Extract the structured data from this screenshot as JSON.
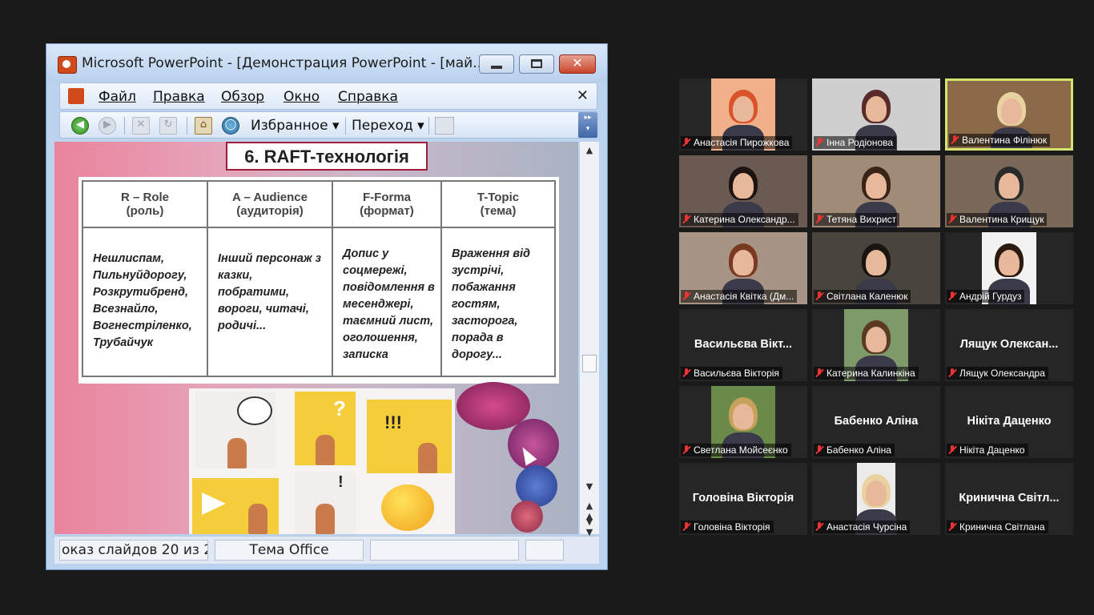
{
  "powerpoint": {
    "title": "Microsoft PowerPoint - [Демонстрация PowerPoint - [май...",
    "window_buttons": {
      "minimize": "",
      "maximize": "",
      "close": "✕"
    },
    "menu": [
      "Файл",
      "Правка",
      "Обзор",
      "Окно",
      "Справка"
    ],
    "menu_close": "✕",
    "toolbar": {
      "favorites": "Избранное ▾",
      "goto": "Переход ▾"
    },
    "slide": {
      "title": "6. RAFT-технологія",
      "headers": [
        {
          "line1": "R – Role",
          "line2": "(роль)"
        },
        {
          "line1": "A – Audience",
          "line2": "(аудиторія)"
        },
        {
          "line1": "F-Forma",
          "line2": "(формат)"
        },
        {
          "line1": "T-Topic",
          "line2": "(тема)"
        }
      ],
      "cells": [
        "Нешлиспам, Пильнуйдорогу, Розкрутибренд, Всезнайло, Вогнестріленко, Трубайчук",
        "Інший персонаж з казки, побратими, вороги, читачі, родичі...",
        "Допис у соцмережі, повідомлення в месенджері, таємний лист, оголошення, записка",
        "Враження від зустрічі, побажання гостям, засторога, порада в дорогу..."
      ],
      "collage_marks": {
        "question": "?",
        "exclaim3": "!!!",
        "exclaim": "!"
      }
    },
    "status": {
      "slides": "оказ слайдов 20 из 2",
      "theme": "Тема Office"
    }
  },
  "participants": [
    {
      "name": "Анастасія Пирожкова",
      "video": true,
      "bigname": ""
    },
    {
      "name": "Інна Родіонова",
      "video": true,
      "bigname": ""
    },
    {
      "name": "Валентина Філінюк",
      "video": true,
      "bigname": "",
      "active": true
    },
    {
      "name": "Катерина Олександр...",
      "video": true,
      "bigname": ""
    },
    {
      "name": "Тетяна Вихрист",
      "video": true,
      "bigname": ""
    },
    {
      "name": "Валентина Крищук",
      "video": true,
      "bigname": ""
    },
    {
      "name": "Анастасія Квітка (Дм...",
      "video": true,
      "bigname": ""
    },
    {
      "name": "Світлана Каленюк",
      "video": true,
      "bigname": ""
    },
    {
      "name": "Андрій Гурдуз",
      "video": true,
      "bigname": ""
    },
    {
      "name": "Васильєва Вікторія",
      "video": false,
      "bigname": "Васильєва Вікт..."
    },
    {
      "name": "Катерина Калинкіна",
      "video": true,
      "bigname": ""
    },
    {
      "name": "Лящук Олександра",
      "video": false,
      "bigname": "Лящук Олексан..."
    },
    {
      "name": "Светлана Мойсеєнко",
      "video": true,
      "bigname": ""
    },
    {
      "name": "Бабенко Аліна",
      "video": false,
      "bigname": "Бабенко Аліна"
    },
    {
      "name": "Нікіта Даценко",
      "video": false,
      "bigname": "Нікіта Даценко"
    },
    {
      "name": "Головіна Вікторія",
      "video": false,
      "bigname": "Головіна Вікторія"
    },
    {
      "name": "Анастасія Чурсіна",
      "video": true,
      "bigname": ""
    },
    {
      "name": "Кринична Світлана",
      "video": false,
      "bigname": "Кринична Світл..."
    }
  ],
  "colors": {
    "active_speaker_border": "#d3e36b",
    "muted_mic": "#e33333",
    "background": "#1a1a1a"
  }
}
